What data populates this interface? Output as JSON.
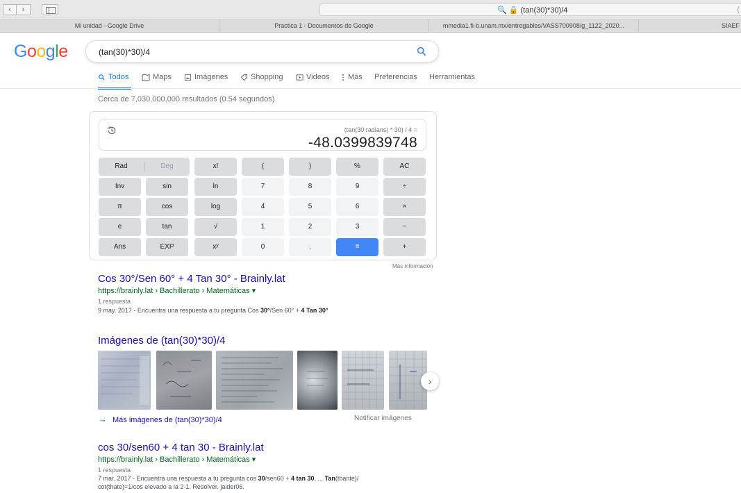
{
  "browser": {
    "address": "(tan(30)*30)/4",
    "address_icons": "🔍 🔒",
    "address_edge": "(",
    "bookmarks": [
      {
        "label": "Mi unidad - Google Drive"
      },
      {
        "label": "Practica 1 - Documentos de Google"
      },
      {
        "label": "mmedia1.fi-b.unam.mx/entregables/VASS700908/g_1122_2020..."
      },
      {
        "label": "SIAEF"
      }
    ]
  },
  "search": {
    "logo": [
      "G",
      "o",
      "o",
      "g",
      "l",
      "e"
    ],
    "query": "(tan(30)*30)/4",
    "tabs": [
      "Todos",
      "Maps",
      "Imágenes",
      "Shopping",
      "Videos",
      "Más",
      "Preferencias",
      "Herramientas"
    ],
    "stats": "Cerca de 7,030,000,000 resultados (0.54 segundos)"
  },
  "calculator": {
    "expression": "(tan(30 radians) * 30) / 4 =",
    "result": "-48.0399839748",
    "rad_label": "Rad",
    "deg_label": "Deg",
    "keys": [
      [
        "x!",
        "(",
        ")",
        "%",
        "AC"
      ],
      [
        "Inv",
        "sin",
        "ln",
        "7",
        "8",
        "9",
        "÷"
      ],
      [
        "π",
        "cos",
        "log",
        "4",
        "5",
        "6",
        "×"
      ],
      [
        "e",
        "tan",
        "√",
        "1",
        "2",
        "3",
        "−"
      ],
      [
        "Ans",
        "EXP",
        "xʸ",
        "0",
        ".",
        "=",
        "+"
      ]
    ],
    "more_info": "Más información"
  },
  "results": [
    {
      "title": "Cos 30°/Sen 60° + 4 Tan 30° - Brainly.lat",
      "url": "https://brainly.lat › Bachillerato › Matemáticas ▾",
      "meta": "1 respuesta",
      "snippet_plain": "9 may. 2017 - Encuentra una respuesta a tu pregunta Cos ",
      "snippet_b1": "30°",
      "snippet_mid": "/Sen 60° + ",
      "snippet_b2": "4 Tan 30°"
    },
    {
      "title": "cos 30/sen60 + 4 tan 30 - Brainly.lat",
      "url": "https://brainly.lat › Bachillerato › Matemáticas ▾",
      "meta": "1 respuesta",
      "snippet_l1_a": "7 mar. 2017 - Encuentra una respuesta a tu pregunta cos ",
      "snippet_l1_b": "30",
      "snippet_l1_c": "/sen60 + ",
      "snippet_l1_d": "4 tan 30",
      "snippet_l1_e": ". ... ",
      "snippet_l1_f": "Tan",
      "snippet_l1_g": "(thante)/",
      "snippet_l2": "cot(thate)=1/cos elevado a la 2-1. Resolver. jaider06."
    }
  ],
  "images": {
    "title": "Imágenes de (tan(30)*30)/4",
    "more": "Más imágenes de (tan(30)*30)/4",
    "report": "Notificar imágenes"
  }
}
